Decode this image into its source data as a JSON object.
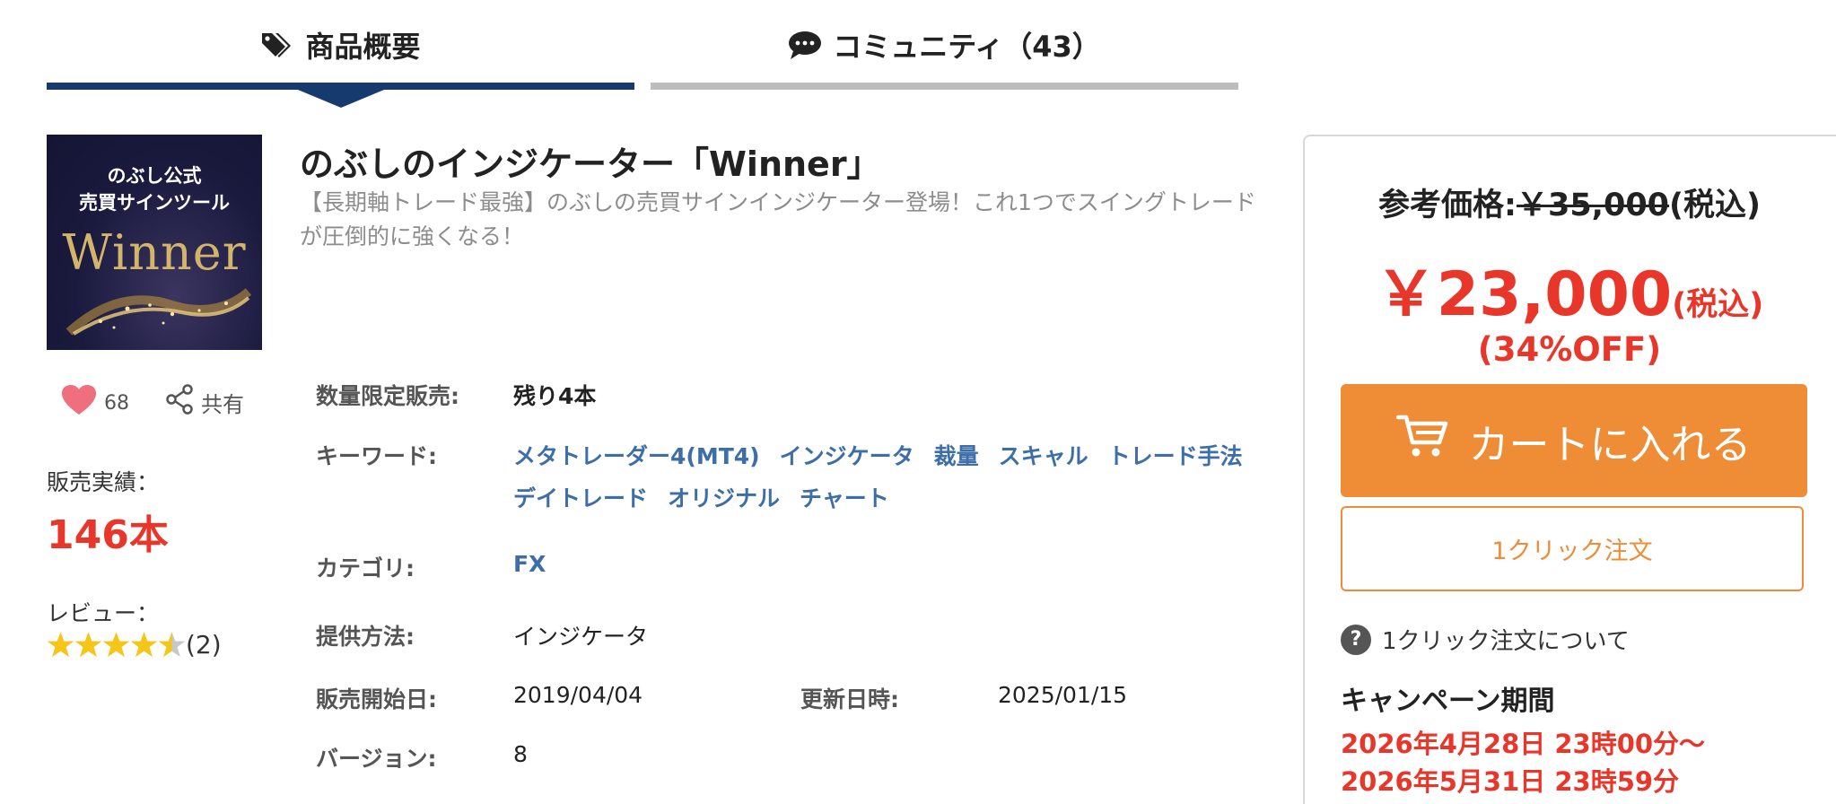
{
  "tabs": {
    "overview": {
      "label": "商品概要",
      "icon": "tag-icon"
    },
    "community": {
      "label": "コミュニティ（43）",
      "icon": "chat-bubble-icon"
    }
  },
  "product_image": {
    "line1": "のぶし公式",
    "line2": "売買サインツール",
    "brand": "Winner"
  },
  "product": {
    "title": "のぶしのインジケーター「Winner」",
    "description": "【長期軸トレード最強】のぶしの売買サインインジケーター登場！これ1つでスイングトレードが圧倒的に強くなる！"
  },
  "social": {
    "like_count": "68",
    "share_label": "共有"
  },
  "sales": {
    "label": "販売実績：",
    "count": "146本"
  },
  "review": {
    "label": "レビュー：",
    "rating": 4.5,
    "count": "(2)"
  },
  "specs": {
    "limited_label": "数量限定販売:",
    "limited_value": "残り4本",
    "keywords_label": "キーワード:",
    "keywords_line1": [
      "メタトレーダー4(MT4)",
      "インジケータ",
      "裁量",
      "スキャル",
      "トレード手法"
    ],
    "keywords_line2": [
      "デイトレード",
      "オリジナル",
      "チャート"
    ],
    "category_label": "カテゴリ:",
    "category_value": "FX",
    "method_label": "提供方法:",
    "method_value": "インジケータ",
    "start_label": "販売開始日:",
    "start_value": "2019/04/04",
    "updated_label": "更新日時:",
    "updated_value": "2025/01/15",
    "version_label": "バージョン:",
    "version_value": "8"
  },
  "purchase": {
    "ref_label": "参考価格:",
    "ref_price": "￥35,000",
    "ref_tax": "(税込)",
    "sale_price": "￥23,000",
    "sale_tax": "(税込)",
    "discount": "(34%OFF)",
    "cart_label": "カートに入れる",
    "oneclick_label": "1クリック注文",
    "help_label": "1クリック注文について",
    "campaign_title": "キャンペーン期間",
    "campaign_start": "2026年4月28日 23時00分〜",
    "campaign_end": "2026年5月31日 23時59分"
  },
  "colors": {
    "accent_blue": "#173a6e",
    "price_red": "#e8362a",
    "cart_orange": "#ef8c36",
    "link_blue": "#3d6ea8"
  }
}
